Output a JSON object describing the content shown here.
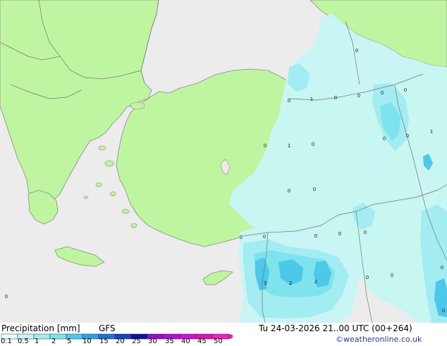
{
  "map": {
    "station_values": [
      "0",
      "0",
      "1",
      "0",
      "0",
      "0",
      "0",
      "0",
      "1",
      "0",
      "0",
      "1",
      "0",
      "0",
      "0",
      "0",
      "0",
      "0",
      "0",
      "0",
      "0",
      "3",
      "2",
      "2",
      "0",
      "0",
      "0",
      "0"
    ],
    "colors": {
      "sea": "#ececec",
      "land": "#bff5a0",
      "precip_light": "#c8f5f5",
      "precip_mid": "#a2ecf2",
      "precip_med": "#7fe3ee",
      "precip_heavy": "#4dc8e8",
      "precip_strong": "#30b0e0",
      "coast": "#8a8a8a",
      "border": "#6e7b6e"
    }
  },
  "footer": {
    "title": "Precipitation [mm]",
    "model": "GFS",
    "valid": "Tu 24-03-2026 21..00 UTC (00+264)",
    "credit": "©weatheronline.co.uk",
    "scale_labels": [
      "0.1",
      "0.5",
      "1",
      "2",
      "5",
      "10",
      "15",
      "20",
      "25",
      "30",
      "35",
      "40",
      "45",
      "50"
    ],
    "scale_colors": [
      "#eafcfc",
      "#c8f5f5",
      "#a2ecf2",
      "#7fe3ee",
      "#4dc8e8",
      "#30a0e0",
      "#2070d8",
      "#1a40c0",
      "#1010a0",
      "#9010c8",
      "#b010d0",
      "#d010d8",
      "#e010b0",
      "#f020c0"
    ]
  }
}
